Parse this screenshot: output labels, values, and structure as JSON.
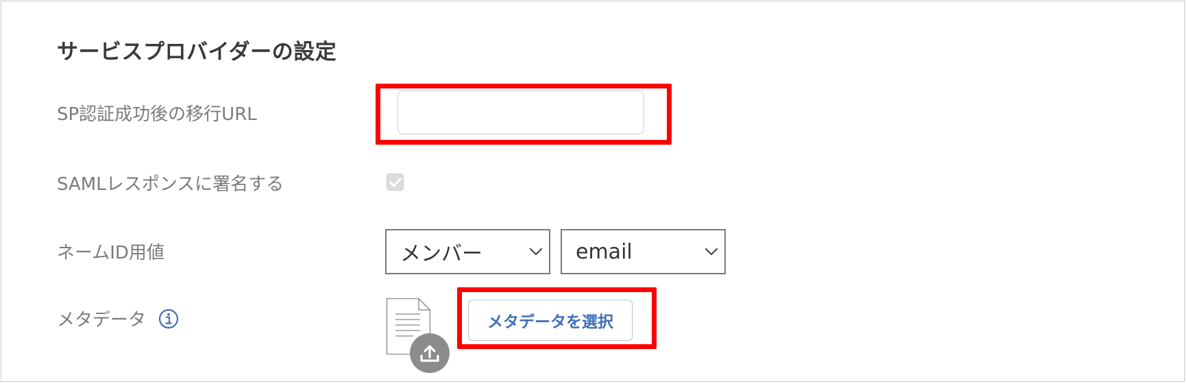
{
  "section": {
    "title": "サービスプロバイダーの設定"
  },
  "fields": {
    "sp_url": {
      "label": "SP認証成功後の移行URL",
      "value": ""
    },
    "saml_sign": {
      "label": "SAMLレスポンスに署名する",
      "checked": true,
      "disabled": true
    },
    "name_id": {
      "label": "ネームID用値",
      "select1": "メンバー",
      "select2": "email"
    },
    "metadata": {
      "label": "メタデータ",
      "button_label": "メタデータを選択"
    }
  },
  "icons": {
    "info": "info-icon",
    "file": "file-icon",
    "upload": "upload-icon",
    "checkmark": "checkmark-icon",
    "chevron": "chevron-down-icon"
  },
  "colors": {
    "highlight": "#ff0000",
    "button_text": "#3f6fb9",
    "info_icon": "#3f6fb9"
  }
}
